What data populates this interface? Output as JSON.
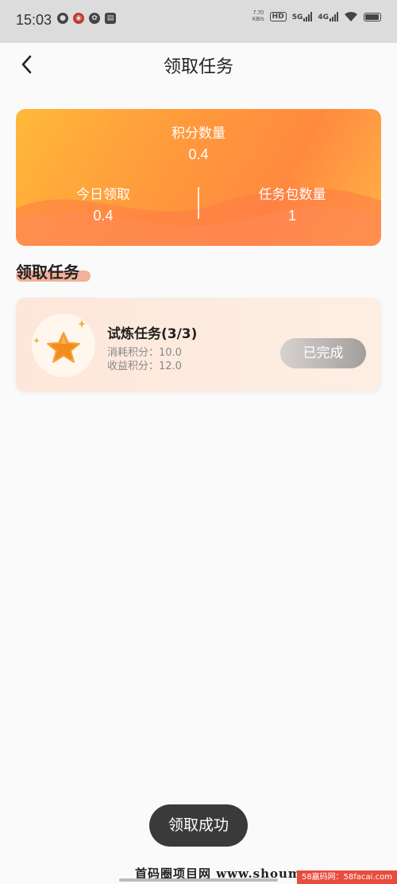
{
  "status_bar": {
    "time": "15:03",
    "speed_value": "7.70",
    "speed_unit": "KB/s",
    "hd_label": "HD",
    "net1": "5G",
    "net2": "4G",
    "icons": [
      "notification-icon",
      "weibo-icon",
      "app-icon",
      "calendar-icon",
      "wifi-icon",
      "battery-icon"
    ]
  },
  "header": {
    "title": "领取任务",
    "back_icon": "chevron-left-icon"
  },
  "summary": {
    "points_label": "积分数量",
    "points_value": "0.4",
    "today_label": "今日领取",
    "today_value": "0.4",
    "packages_label": "任务包数量",
    "packages_value": "1"
  },
  "section": {
    "title": "领取任务"
  },
  "task": {
    "name": "试炼任务(3/3)",
    "cost": "消耗积分：10.0",
    "income": "收益积分：12.0",
    "button_label": "已完成",
    "icon": "star-icon"
  },
  "toast": {
    "message": "领取成功"
  },
  "watermark": {
    "text": "首码圈项目网 www.shoumaquan.com",
    "badge": "58赢码网：58facai.com"
  },
  "colors": {
    "card_orange": "#ff9a3c",
    "card_yellow": "#ffb83a",
    "task_bg": "#fde7d9",
    "button_gray": "#a29e9c",
    "toast_bg": "#3a3a3a"
  }
}
